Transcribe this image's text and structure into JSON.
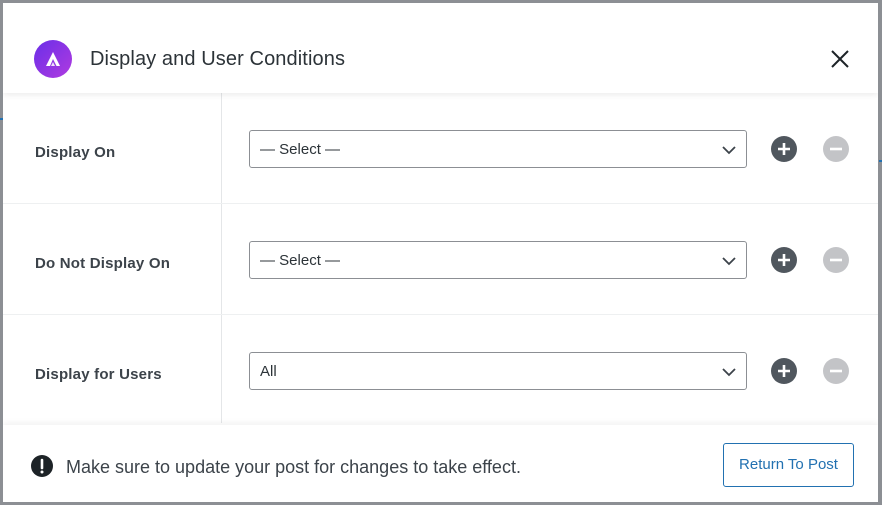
{
  "modal": {
    "title": "Display and User Conditions",
    "logo_icon": "astra-logo-icon",
    "close_icon": "close-icon"
  },
  "rows": [
    {
      "label": "Display On",
      "select_value": "— Select —"
    },
    {
      "label": "Do Not Display On",
      "select_value": "— Select —"
    },
    {
      "label": "Display for Users",
      "select_value": "All"
    }
  ],
  "footer": {
    "notice": "Make sure to update your post for changes to take effect.",
    "notice_icon": "exclamation-circle-icon",
    "return_button": "Return To Post"
  },
  "colors": {
    "logo_gradient_start": "#6a2ee8",
    "logo_gradient_end": "#b03be0",
    "add_button": "#50575e",
    "remove_button": "#c3c4c7",
    "accent": "#2271b1"
  }
}
